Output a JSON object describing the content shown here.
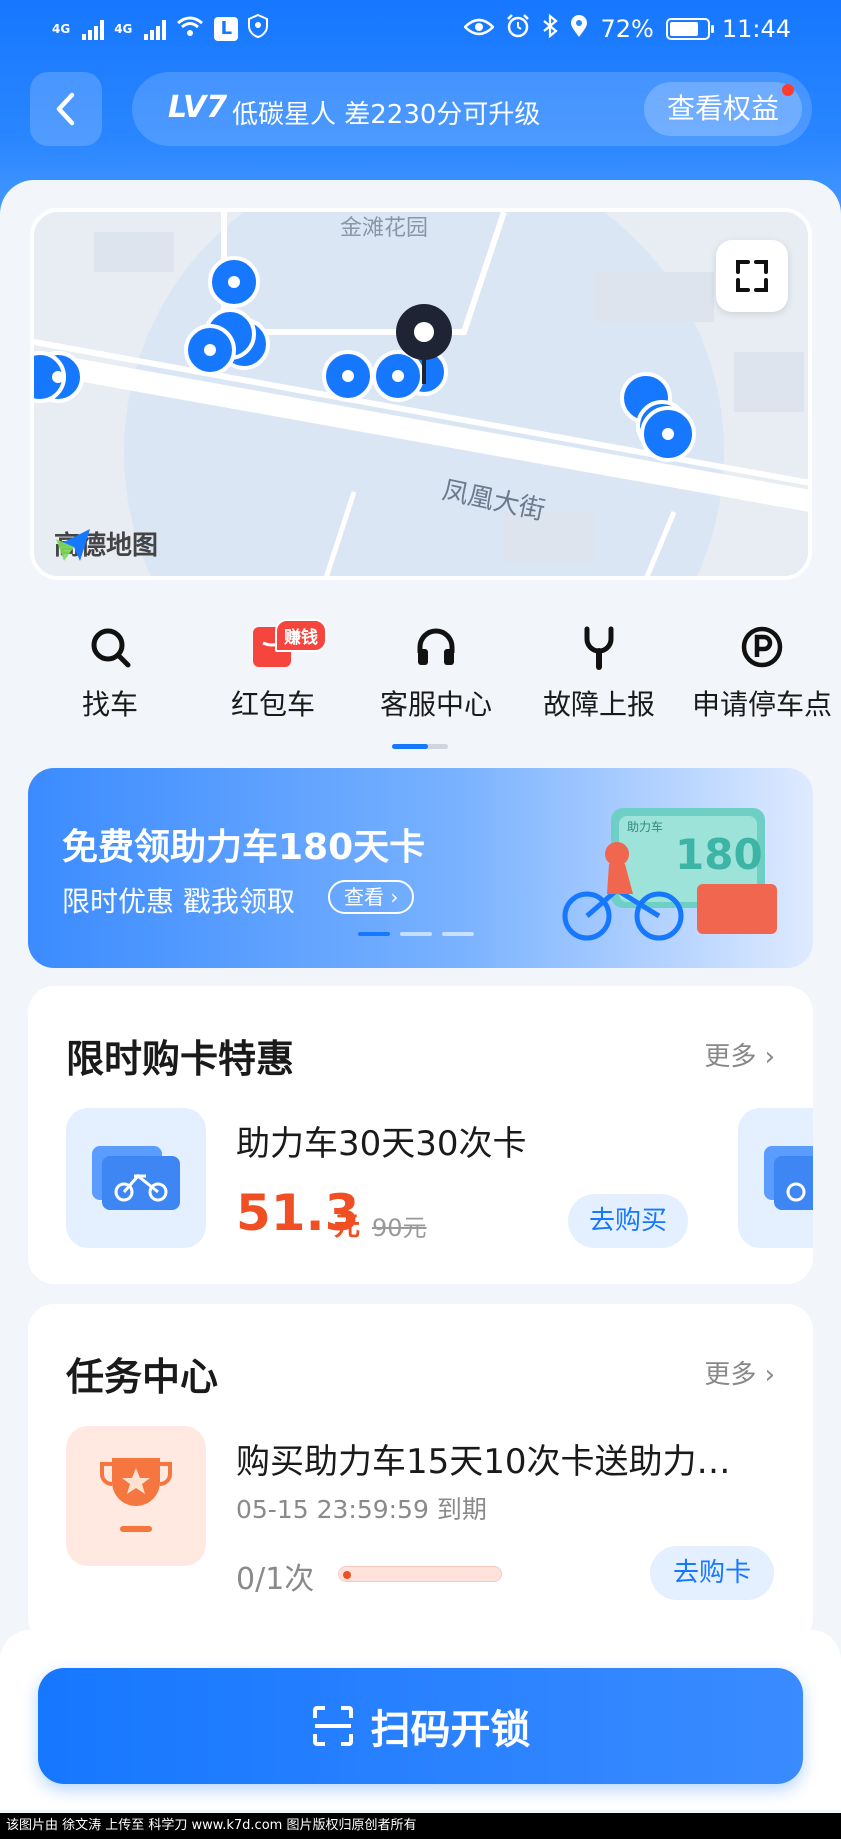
{
  "status_bar": {
    "signal1": "4G",
    "signal2": "4G",
    "battery": "72%",
    "time": "11:44",
    "app_badge": "L"
  },
  "header": {
    "level_badge": "LV7",
    "level_text": "低碳星人 差2230分可升级",
    "rights_button": "查看权益"
  },
  "map": {
    "street_label": "凤凰大街",
    "area_label": "金滩花园",
    "provider": "高德地图"
  },
  "quick_nav": [
    {
      "label": "找车",
      "icon": "search-icon"
    },
    {
      "label": "红包车",
      "icon": "redpacket-icon",
      "tag": "赚钱"
    },
    {
      "label": "客服中心",
      "icon": "headset-icon"
    },
    {
      "label": "故障上报",
      "icon": "wrench-icon"
    },
    {
      "label": "申请停车点",
      "icon": "parking-icon"
    }
  ],
  "banner": {
    "title": "免费领助力车180天卡",
    "subtitle": "限时优惠 戳我领取",
    "button": "查看",
    "card_text": "180",
    "card_label": "助力车"
  },
  "card_deals": {
    "title": "限时购卡特惠",
    "more": "更多",
    "product": {
      "name": "助力车30天30次卡",
      "price": "51.3",
      "unit": "元",
      "original_price": "90元",
      "button": "去购买"
    }
  },
  "task_center": {
    "title": "任务中心",
    "more": "更多",
    "task": {
      "name": "购买助力车15天10次卡送助力…",
      "expire": "05-15 23:59:59 到期",
      "progress": "0/1次",
      "progress_fraction": 0,
      "button": "去购卡"
    }
  },
  "scan_button": "扫码开锁",
  "watermark": "该图片由 徐文涛 上传至 科学刀 www.k7d.com 图片版权归原创者所有",
  "colors": {
    "primary": "#1677ff",
    "price": "#f04e23"
  }
}
